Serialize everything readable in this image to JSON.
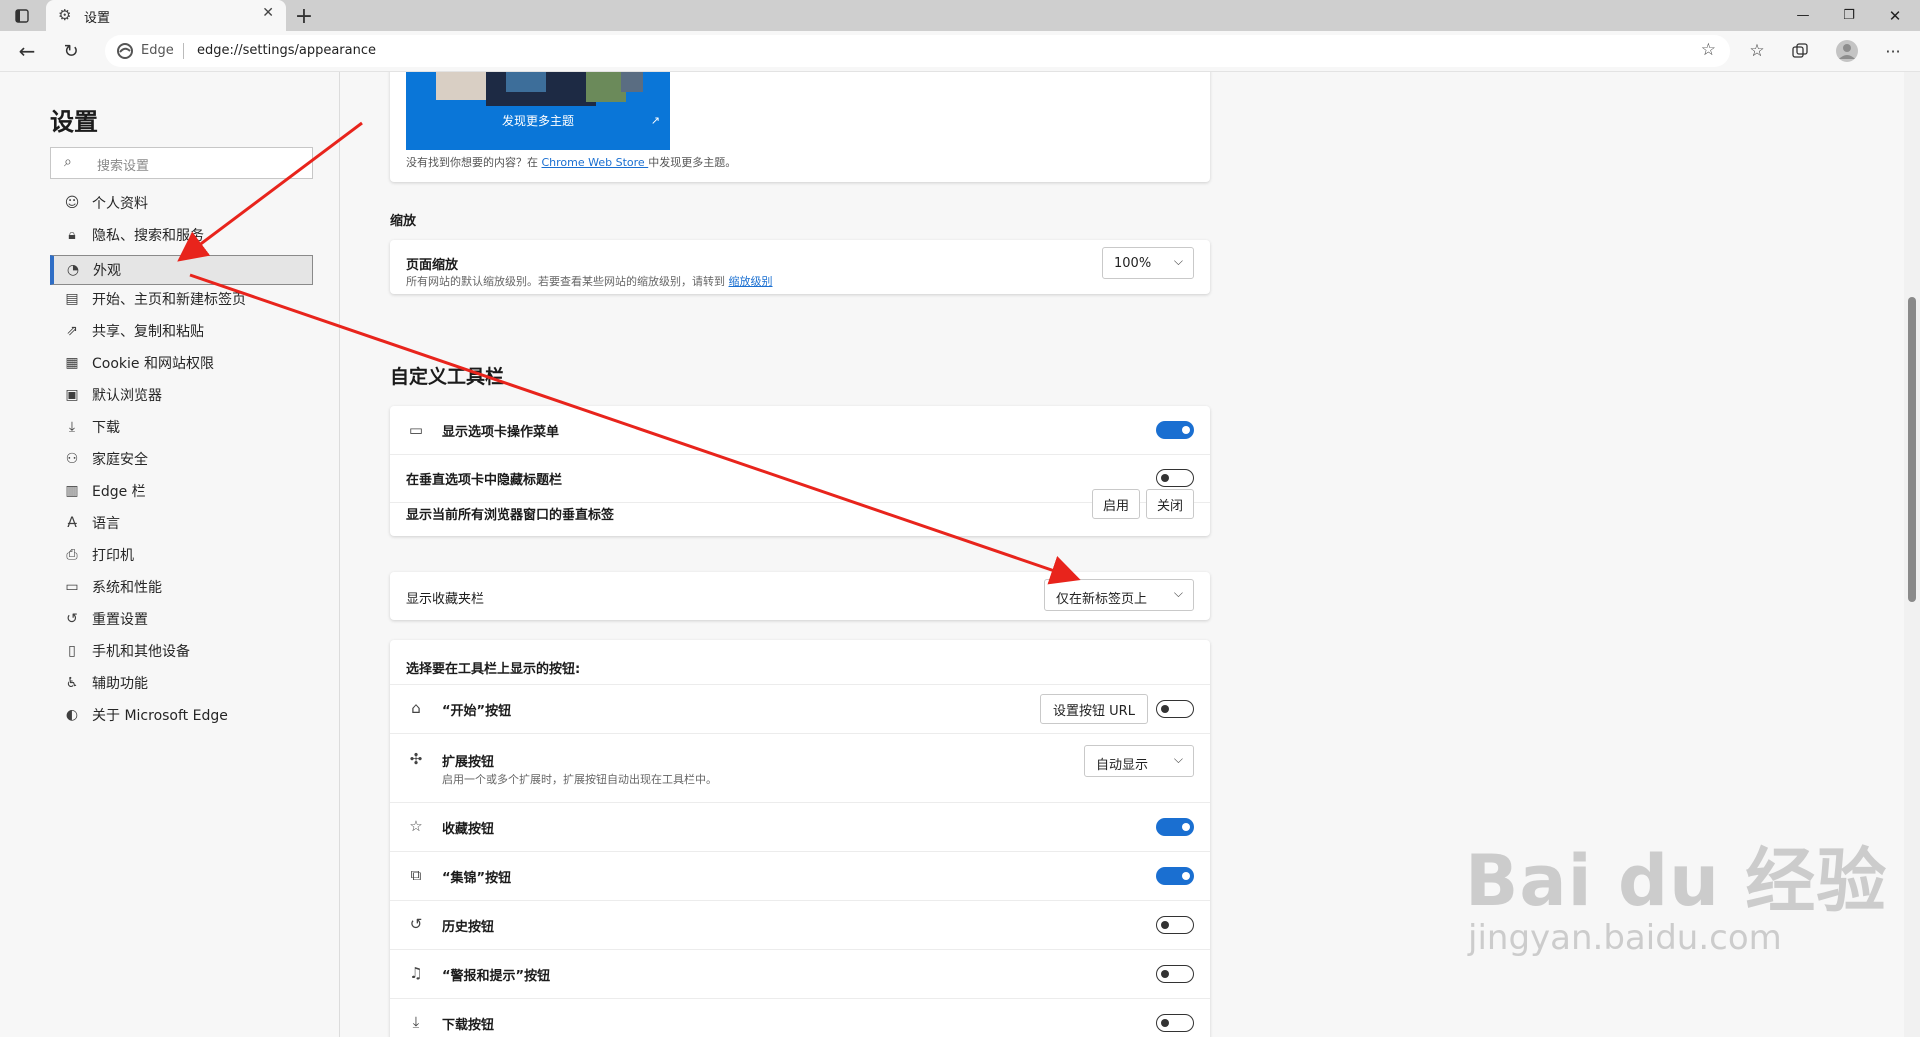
{
  "browser": {
    "tab_title": "设置",
    "brand_label": "Edge",
    "url": "edge://settings/appearance"
  },
  "sidebar": {
    "title": "设置",
    "search_placeholder": "搜索设置",
    "items": [
      {
        "label": "个人资料",
        "icon": "profile-icon"
      },
      {
        "label": "隐私、搜索和服务",
        "icon": "lock-icon"
      },
      {
        "label": "外观",
        "icon": "palette-icon",
        "active": true
      },
      {
        "label": "开始、主页和新建标签页",
        "icon": "home-tab-icon"
      },
      {
        "label": "共享、复制和粘贴",
        "icon": "share-icon"
      },
      {
        "label": "Cookie 和网站权限",
        "icon": "cookie-icon"
      },
      {
        "label": "默认浏览器",
        "icon": "browser-icon"
      },
      {
        "label": "下载",
        "icon": "download-icon"
      },
      {
        "label": "家庭安全",
        "icon": "family-icon"
      },
      {
        "label": "Edge 栏",
        "icon": "edge-bar-icon"
      },
      {
        "label": "语言",
        "icon": "language-icon"
      },
      {
        "label": "打印机",
        "icon": "printer-icon"
      },
      {
        "label": "系统和性能",
        "icon": "laptop-icon"
      },
      {
        "label": "重置设置",
        "icon": "reset-icon"
      },
      {
        "label": "手机和其他设备",
        "icon": "phone-icon"
      },
      {
        "label": "辅助功能",
        "icon": "accessibility-icon"
      },
      {
        "label": "关于 Microsoft Edge",
        "icon": "edge-logo-icon"
      }
    ]
  },
  "themes": {
    "discover_label": "发现更多主题",
    "note_before": "没有找到你想要的内容？在 ",
    "note_link": "Chrome Web Store ",
    "note_after": "中发现更多主题。"
  },
  "zoom": {
    "section_title": "缩放",
    "label": "页面缩放",
    "desc": "所有网站的默认缩放级别。若要查看某些网站的缩放级别，请转到 ",
    "desc_link": "缩放级别",
    "value": "100%"
  },
  "toolbar": {
    "title": "自定义工具栏",
    "tab_actions_menu": "显示选项卡操作菜单",
    "hide_title_bar": "在垂直选项卡中隐藏标题栏",
    "vertical_tabs": "显示当前所有浏览器窗口的垂直标签",
    "enable_label": "启用",
    "disable_label": "关闭",
    "favorites_bar_label": "显示收藏夹栏",
    "favorites_bar_value": "仅在新标签页上",
    "buttons_heading": "选择要在工具栏上显示的按钮:",
    "home_button": "“开始”按钮",
    "home_url_button": "设置按钮 URL",
    "extensions_button": "扩展按钮",
    "extensions_desc": "启用一个或多个扩展时，扩展按钮自动出现在工具栏中。",
    "extensions_value": "自动显示",
    "favorites_button": "收藏按钮",
    "collections_button": "“集锦”按钮",
    "history_button": "历史按钮",
    "alerts_button": "“警报和提示”按钮",
    "downloads_button": "下载按钮"
  },
  "toggles": {
    "tab_actions_menu": true,
    "hide_title_bar": false,
    "home_button": false,
    "favorites_button": true,
    "collections_button": true,
    "history_button": false,
    "alerts_button": false,
    "downloads_button": false
  },
  "watermark": {
    "line1": "Bai du 经验",
    "line2": "jingyan.baidu.com"
  },
  "colors": {
    "accent": "#1a6fd1",
    "annotation_arrow": "#e8241c"
  }
}
